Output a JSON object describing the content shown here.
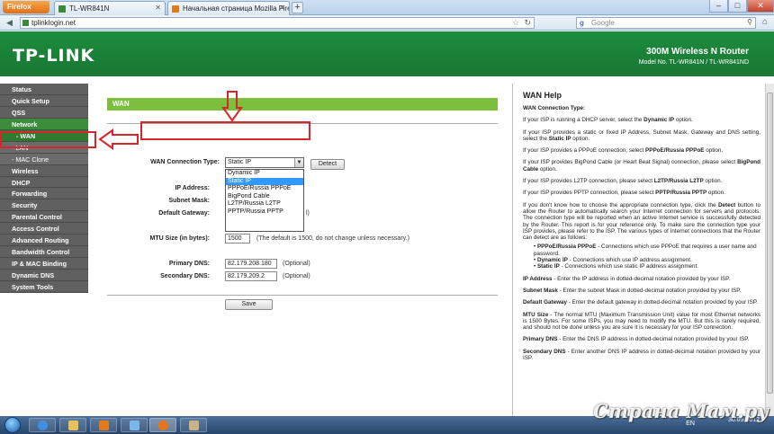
{
  "browser": {
    "firefox_button": "Firefox",
    "tabs": [
      {
        "label": "TL-WR841N",
        "active": true
      },
      {
        "label": "Начальная страница Mozilla Firefox",
        "active": false
      }
    ],
    "url": "tplinklogin.net",
    "search_placeholder": "Google"
  },
  "router": {
    "logo": "TP-LINK",
    "model_title": "300M Wireless N Router",
    "model_no": "Model No. TL-WR841N / TL-WR841ND"
  },
  "menu": [
    {
      "label": "Status",
      "type": "main"
    },
    {
      "label": "Quick Setup",
      "type": "main"
    },
    {
      "label": "QSS",
      "type": "main"
    },
    {
      "label": "Network",
      "type": "group"
    },
    {
      "label": "- WAN",
      "type": "active"
    },
    {
      "label": "- LAN",
      "type": "sub"
    },
    {
      "label": "- MAC Clone",
      "type": "sub"
    },
    {
      "label": "Wireless",
      "type": "main"
    },
    {
      "label": "DHCP",
      "type": "main"
    },
    {
      "label": "Forwarding",
      "type": "main"
    },
    {
      "label": "Security",
      "type": "main"
    },
    {
      "label": "Parental Control",
      "type": "main"
    },
    {
      "label": "Access Control",
      "type": "main"
    },
    {
      "label": "Advanced Routing",
      "type": "main"
    },
    {
      "label": "Bandwidth Control",
      "type": "main"
    },
    {
      "label": "IP & MAC Binding",
      "type": "main"
    },
    {
      "label": "Dynamic DNS",
      "type": "main"
    },
    {
      "label": "System Tools",
      "type": "main"
    }
  ],
  "wan": {
    "section_title": "WAN",
    "conn_type_label": "WAN Connection Type:",
    "conn_type_value": "Static IP",
    "detect_label": "Detect",
    "dropdown_options": [
      {
        "label": "Dynamic IP",
        "selected": false
      },
      {
        "label": "Static IP",
        "selected": true
      },
      {
        "label": "PPPoE/Russia PPPoE",
        "selected": false
      },
      {
        "label": "BigPond Cable",
        "selected": false
      },
      {
        "label": "L2TP/Russia L2TP",
        "selected": false
      },
      {
        "label": "PPTP/Russia PPTP",
        "selected": false
      }
    ],
    "ip_label": "IP Address:",
    "subnet_label": "Subnet Mask:",
    "gateway_label": "Default Gateway:",
    "gateway_hint_fragment": "l)",
    "mtu_label": "MTU Size (in bytes):",
    "mtu_value": "1500",
    "mtu_hint": "(The default is 1500, do not change unless necessary.)",
    "primary_dns_label": "Primary DNS:",
    "primary_dns_value": "82.179.208.180",
    "secondary_dns_label": "Secondary DNS:",
    "secondary_dns_value": "82.179.209.2",
    "optional": "(Optional)",
    "save_label": "Save"
  },
  "help": {
    "title": "WAN Help",
    "conn_type_heading": "WAN Connection Type:",
    "p1_pre": "If your ISP is running a DHCP server, select the ",
    "p1_b": "Dynamic IP",
    "p1_post": " option.",
    "p2_pre": "If your ISP provides a static or fixed IP Address, Subnet Mask, Gateway and DNS setting, select the ",
    "p2_b": "Static IP",
    "p2_post": " option.",
    "p3_pre": "If your ISP provides a PPPoE connection, select ",
    "p3_b": "PPPoE/Russia PPPoE",
    "p3_post": " option.",
    "p4_pre": "If your ISP provides BigPond Cable (or Heart Beat Signal) connection, please select ",
    "p4_b": "BigPond Cable",
    "p4_post": " option.",
    "p5_pre": "If your ISP provides L2TP connection, please select ",
    "p5_b": "L2TP/Russia L2TP",
    "p5_post": " option.",
    "p6_pre": "If your ISP provides PPTP connection, please select ",
    "p6_b": "PPTP/Russia PPTP",
    "p6_post": " option.",
    "p7_pre": "If you don't know how to choose the appropriate connection type, click the ",
    "p7_b": "Detect",
    "p7_post": " button to allow the Router to automatically search your Internet connection for servers and protocols. The connection type will be reported when an active Internet service is successfully detected by the Router. This report is for your reference only. To make sure the connection type your ISP provides, please refer to the ISP. The various types of Internet connections that the Router can detect are as follows:",
    "b1_b": "PPPoE/Russia PPPoE",
    "b1_t": " - Connections which use PPPoE that requires a user name and password.",
    "b2_b": "Dynamic IP",
    "b2_t": " - Connections which use IP address assignment.",
    "b3_b": "Static IP",
    "b3_t": " - Connections which use static IP address assignment.",
    "ip_b": "IP Address",
    "ip_t": " - Enter the IP address in dotted-decimal notation provided by your ISP.",
    "sm_b": "Subnet Mask",
    "sm_t": " - Enter the subnet Mask in dotted-decimal notation provided by your ISP.",
    "gw_b": "Default Gateway",
    "gw_t": " - Enter the default gateway in dotted-decimal notation provided by your ISP.",
    "mtu_b": "MTU Size",
    "mtu_t": " - The normal MTU (Maximum Transmission Unit) value for most Ethernet networks is 1500 Bytes. For some ISPs, you may need to modify the MTU. But this is rarely required, and should not be done unless you are sure it is necessary for your ISP connection.",
    "pd_b": "Primary DNS",
    "pd_t": " - Enter the DNS IP address in dotted-decimal notation provided by your ISP.",
    "sd_b": "Secondary DNS",
    "sd_t": " - Enter another DNS IP address in dotted-decimal notation provided by your ISP."
  },
  "taskbar": {
    "lang": "EN",
    "clock_time": "",
    "clock_date": "30.09.2012"
  },
  "watermark": "Страна Мам.ру",
  "colors": {
    "brand_green": "#1a7734",
    "section_green": "#7bbf3c",
    "annotation_red": "#d5262d",
    "selection_blue": "#3399ff"
  }
}
